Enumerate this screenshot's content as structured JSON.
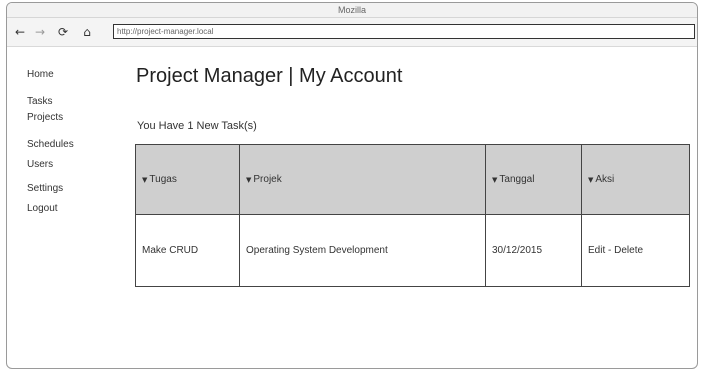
{
  "window": {
    "title": "Mozilla"
  },
  "browser": {
    "url": "http://project-manager.local",
    "back_icon": "back-arrow-icon",
    "forward_icon": "forward-arrow-icon",
    "reload_icon": "reload-icon",
    "home_icon": "home-icon"
  },
  "sidebar": {
    "items": [
      {
        "label": "Home"
      },
      {
        "label": "Tasks"
      },
      {
        "label": "Projects"
      },
      {
        "label": "Schedules"
      },
      {
        "label": "Users"
      },
      {
        "label": "Settings"
      },
      {
        "label": "Logout"
      }
    ]
  },
  "main": {
    "title": "Project Manager | My Account",
    "notice": "You Have 1 New Task(s)",
    "table": {
      "headers": [
        "Tugas",
        "Projek",
        "Tanggal",
        "Aksi"
      ],
      "rows": [
        {
          "tugas": "Make CRUD",
          "projek": "Operating System Development",
          "tanggal": "30/12/2015",
          "edit": "Edit",
          "separator": " - ",
          "delete": "Delete"
        }
      ]
    }
  },
  "colors": {
    "table_header_bg": "#cfcfcf",
    "border": "#444444"
  }
}
